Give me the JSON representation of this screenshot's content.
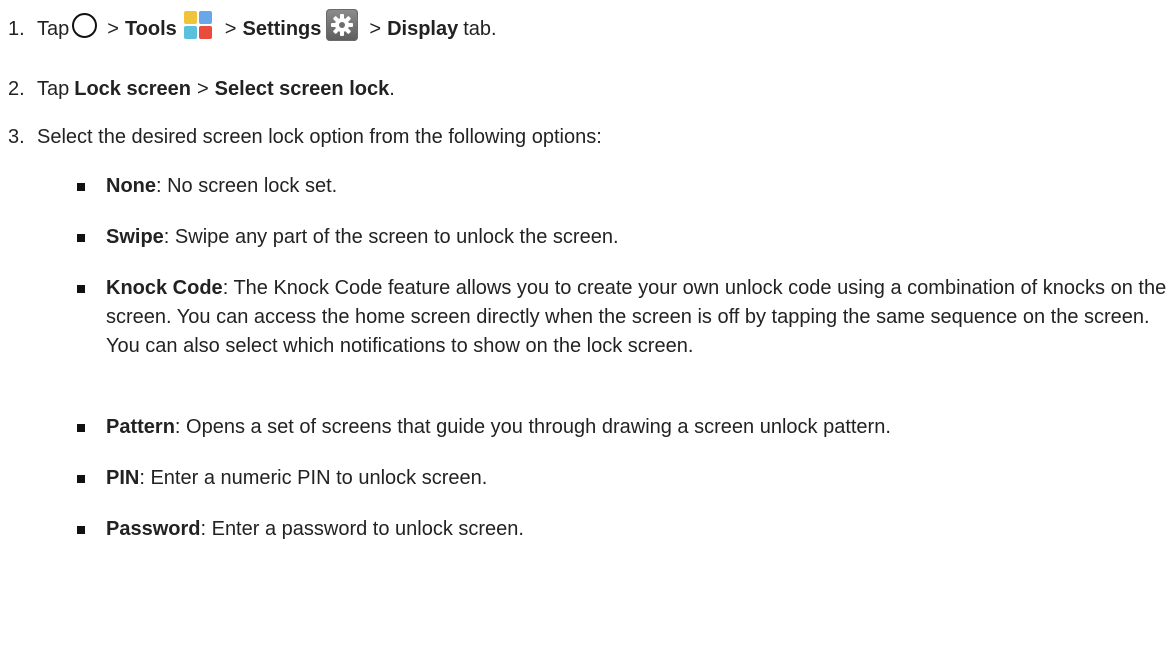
{
  "steps": [
    {
      "number": "1.",
      "parts": {
        "tap": "Tap",
        "sep1": ">",
        "tools": "Tools",
        "sep2": ">",
        "settings": "Settings",
        "sep3": ">",
        "display": "Display",
        "suffix": "tab."
      },
      "icons": [
        "home-circle-icon",
        "tools-folder-icon",
        "settings-gear-icon"
      ]
    },
    {
      "number": "2.",
      "parts": {
        "tap": "Tap",
        "lock_screen": "Lock screen",
        "sep": ">",
        "select_screen_lock": "Select screen lock",
        "end": "."
      }
    },
    {
      "number": "3.",
      "text": "Select the desired screen lock option from the following options:"
    }
  ],
  "options": [
    {
      "term": "None",
      "desc": ": No screen lock set."
    },
    {
      "term": "Swipe",
      "desc": ": Swipe any part of the screen to unlock the screen."
    },
    {
      "term": "Knock Code",
      "desc": ": The Knock Code feature allows you to create your own unlock code using a combination of knocks on the screen. You can access the home screen directly when the screen is off by tapping the same sequence on the screen. You can also select which notifications to show on the lock screen."
    },
    {
      "term": "Pattern",
      "desc": ": Opens a set of screens that guide you through drawing a screen unlock pattern."
    },
    {
      "term": "PIN",
      "desc": ": Enter a numeric PIN to unlock screen."
    },
    {
      "term": "Password",
      "desc": ": Enter a password to unlock screen."
    }
  ],
  "colors": {
    "text": "#222222",
    "tools_icon": [
      "#f0c43a",
      "#6aa7e8",
      "#5bc0de",
      "#e94b3c"
    ],
    "settings_icon": "#6e6e6e"
  }
}
